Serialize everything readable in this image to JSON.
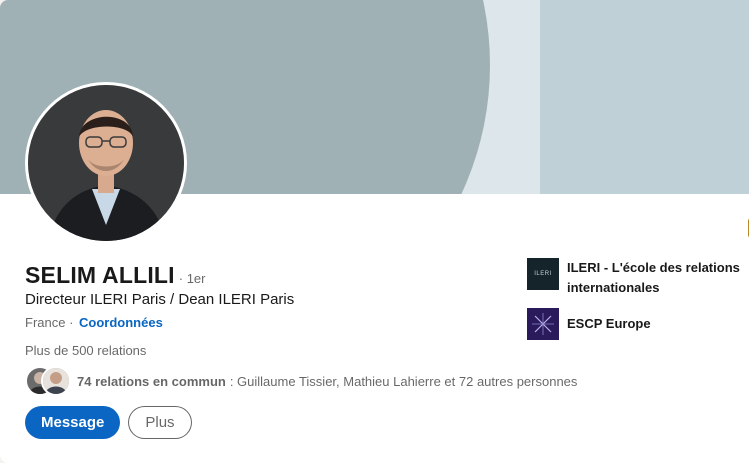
{
  "profile": {
    "name": "SELIM ALLILI",
    "degree": "· 1er",
    "headline": "Directeur ILERI Paris / Dean ILERI Paris",
    "location": "France ·",
    "contact_link": "Coordonnées",
    "connections": "Plus de 500 relations",
    "mutual_count": "74 relations en commun",
    "mutual_names": ": Guillaume Tissier, Mathieu Lahierre et 72 autres personnes"
  },
  "actions": {
    "message_label": "Message",
    "more_label": "Plus"
  },
  "organizations": [
    {
      "name": "ILERI - L'école des relations internationales",
      "logo_text": "ILERI"
    },
    {
      "name": "ESCP Europe",
      "logo_text": ""
    }
  ],
  "colors": {
    "accent": "#0a66c2",
    "banner_blob": "#9fb1b5",
    "banner_bg": "#dde6ea",
    "banner_panel": "#bfd1d6"
  }
}
